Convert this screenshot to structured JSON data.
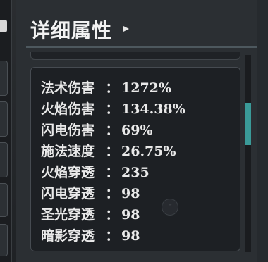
{
  "panel": {
    "title": "详细属性"
  },
  "stats": [
    {
      "name": "法术伤害",
      "sep": "：",
      "value": "1272%"
    },
    {
      "name": "火焰伤害",
      "sep": "：",
      "value": "134.38%"
    },
    {
      "name": "闪电伤害",
      "sep": "：",
      "value": "69%"
    },
    {
      "name": "施法速度",
      "sep": "：",
      "value": "26.75%"
    },
    {
      "name": "火焰穿透",
      "sep": "：",
      "value": "235"
    },
    {
      "name": "闪电穿透",
      "sep": "：",
      "value": "98"
    },
    {
      "name": "圣光穿透",
      "sep": "：",
      "value": "98"
    },
    {
      "name": "暗影穿透",
      "sep": "：",
      "value": "98"
    }
  ],
  "hint_key": "E",
  "colors": {
    "accent": "#3a9a98",
    "text": "#e9e9e9",
    "panel_bg": "#2b2f33"
  }
}
